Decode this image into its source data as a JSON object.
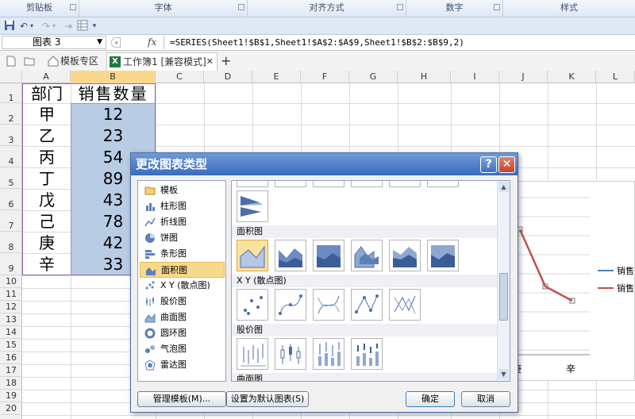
{
  "ribbon": {
    "groups": [
      "剪贴板",
      "字体",
      "对齐方式",
      "数字",
      "样式"
    ]
  },
  "formula_bar": {
    "name_box": "图表 3",
    "fx_label": "fx",
    "formula": "=SERIES(Sheet1!$B$1,Sheet1!$A$2:$A$9,Sheet1!$B$2:$B$9,2)"
  },
  "tabs": {
    "template_tab": "模板专区",
    "workbook_tab": "工作簿1 [兼容模式]",
    "close": "✕",
    "add": "+"
  },
  "columns": [
    "A",
    "B",
    "C",
    "D",
    "E",
    "F",
    "G",
    "H",
    "I",
    "J",
    "K",
    "L"
  ],
  "rows": [
    "1",
    "2",
    "3",
    "4",
    "5",
    "6",
    "7",
    "8",
    "9",
    "10",
    "11",
    "12",
    "13",
    "14",
    "15",
    "16",
    "17",
    "18",
    "19",
    "20"
  ],
  "sheet": {
    "header_a": "部门",
    "header_b": "销售数量",
    "departments": [
      "甲",
      "乙",
      "丙",
      "丁",
      "戊",
      "己",
      "庚",
      "辛"
    ],
    "quantities": [
      "12",
      "23",
      "54",
      "89",
      "43",
      "78",
      "42",
      "33"
    ]
  },
  "chart": {
    "x_labels": [
      "庚",
      "辛"
    ],
    "legend": [
      "销售",
      "销售"
    ],
    "series_color_1": "#4f81bd",
    "series_color_2": "#c0504d"
  },
  "dialog": {
    "title": "更改图表类型",
    "help": "?",
    "close": "✕",
    "categories": [
      "模板",
      "柱形图",
      "折线图",
      "饼图",
      "条形图",
      "面积图",
      "X Y (散点图)",
      "股价图",
      "曲面图",
      "圆环图",
      "气泡图",
      "雷达图"
    ],
    "selected_category": "面积图",
    "sections": [
      "面积图",
      "X Y (散点图)",
      "股价图",
      "曲面图"
    ],
    "buttons": {
      "manage": "管理模板(M)...",
      "set_default": "设置为默认图表(S)",
      "ok": "确定",
      "cancel": "取消"
    }
  }
}
